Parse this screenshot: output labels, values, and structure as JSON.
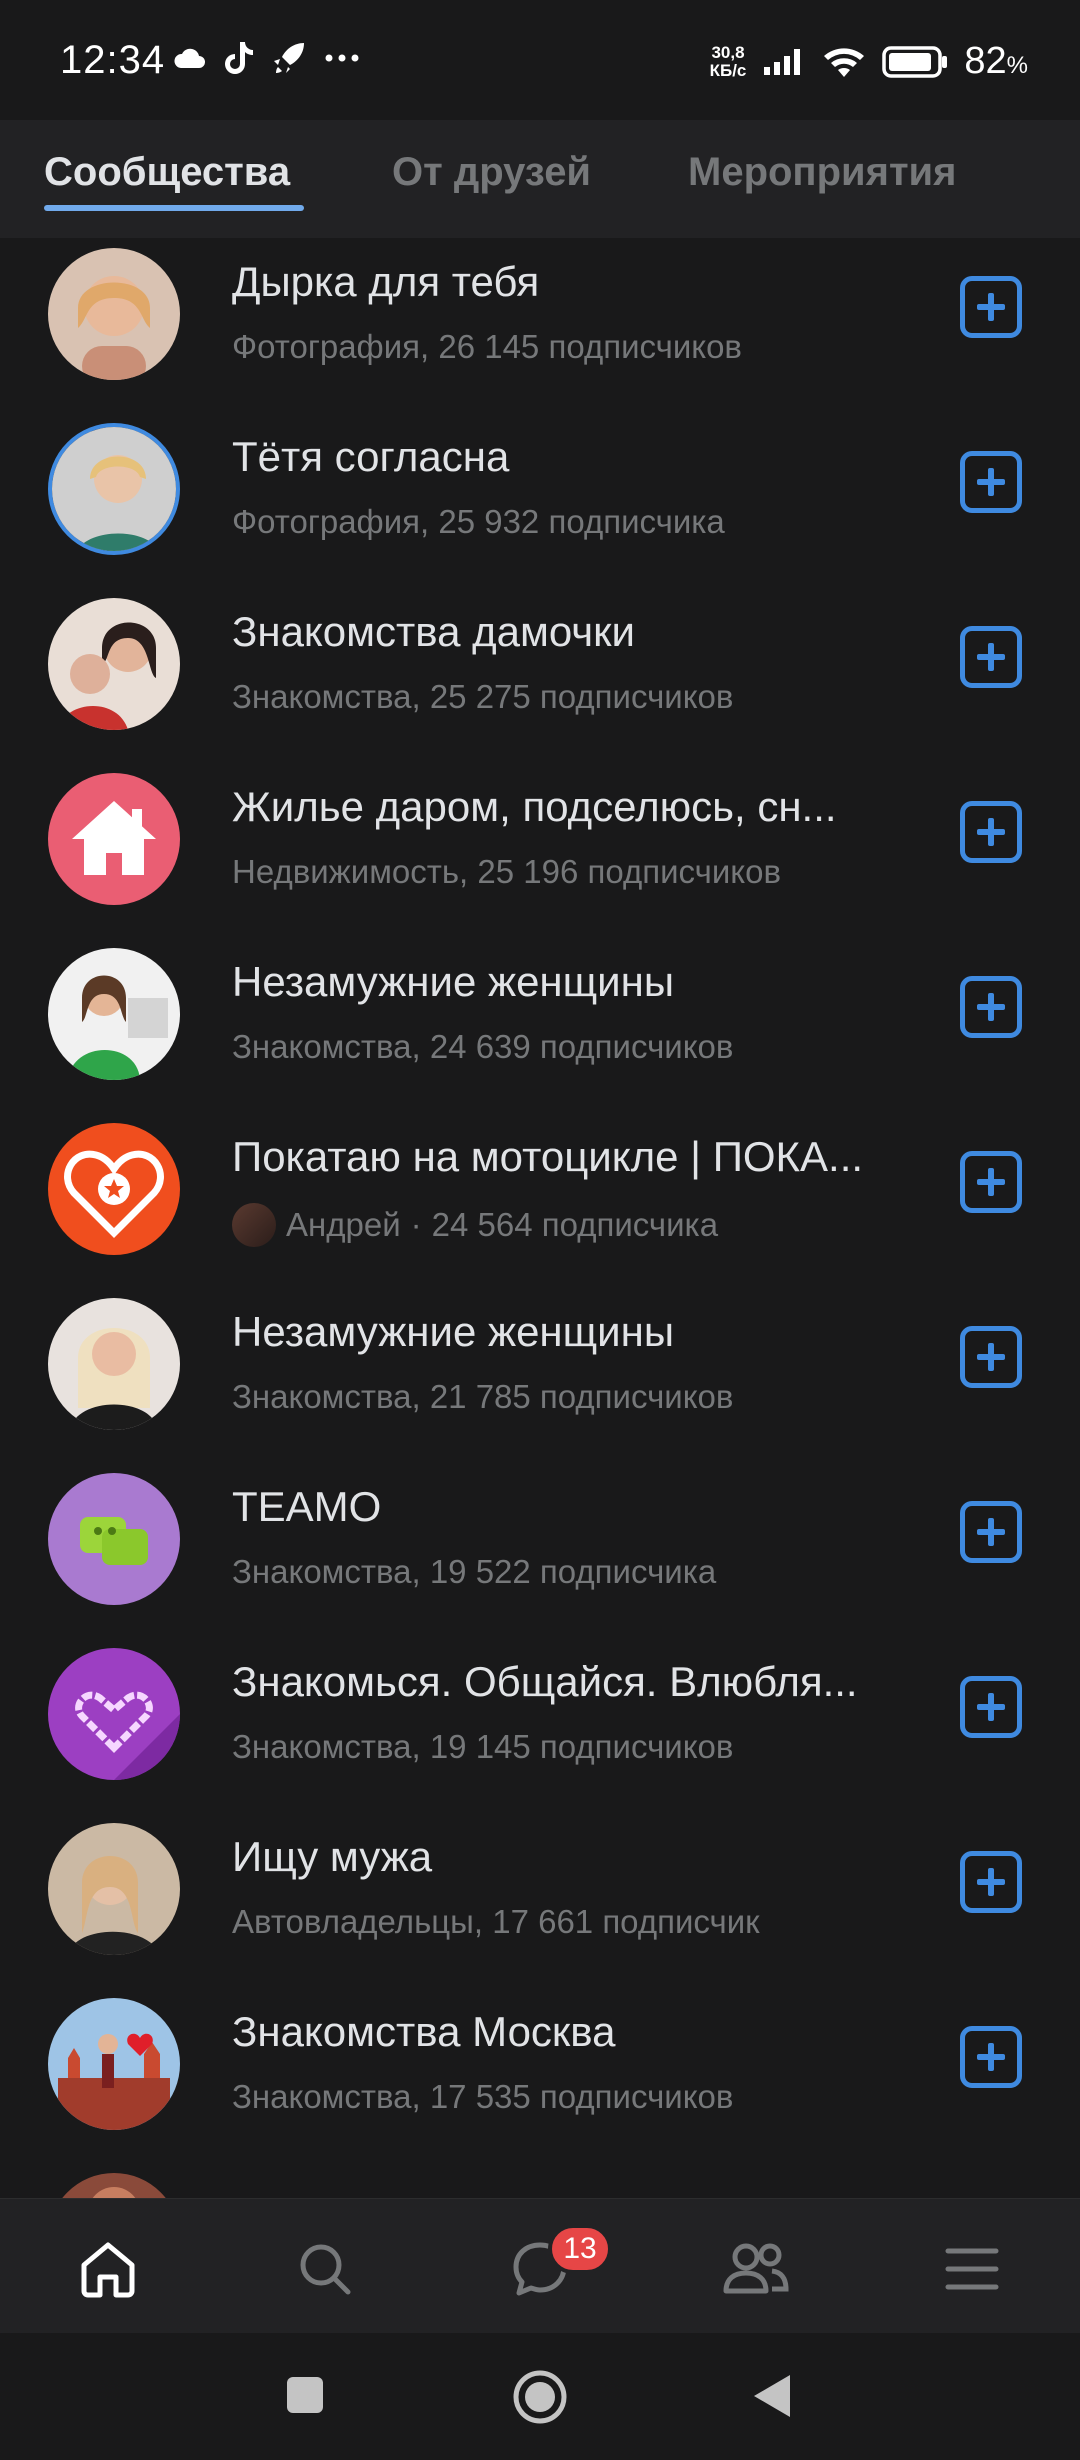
{
  "status_bar": {
    "time": "12:34",
    "net_speed_value": "30,8",
    "net_speed_unit": "КБ/с",
    "battery": "82",
    "battery_unit": "%"
  },
  "tabs": [
    {
      "label": "Сообщества",
      "active": true
    },
    {
      "label": "От друзей",
      "active": false
    },
    {
      "label": "Мероприятия",
      "active": false
    }
  ],
  "communities": [
    {
      "title": "Дырка для тебя",
      "subtitle": "Фотография, 26 145 подписчиков",
      "avatar_icon": "photo-avatar"
    },
    {
      "title": "Тётя согласна",
      "subtitle": "Фотография, 25 932 подписчика",
      "avatar_icon": "photo-avatar"
    },
    {
      "title": "Знакомства дамочки",
      "subtitle": "Знакомства, 25 275 подписчиков",
      "avatar_icon": "photo-avatar"
    },
    {
      "title": "Жилье даром, подселюсь, сн...",
      "subtitle": "Недвижимость, 25 196 подписчиков",
      "avatar_icon": "house-icon"
    },
    {
      "title": "Незамужние женщины",
      "subtitle": "Знакомства, 24 639 подписчиков",
      "avatar_icon": "photo-avatar"
    },
    {
      "title": "Покатаю на мотоцикле | ПОКА...",
      "owner": "Андрей",
      "separator": "·",
      "subscribers": "24 564 подписчика",
      "avatar_icon": "heart-star-logo"
    },
    {
      "title": "Незамужние женщины",
      "subtitle": "Знакомства, 21 785 подписчиков",
      "avatar_icon": "photo-avatar"
    },
    {
      "title": "TEAMO",
      "subtitle": "Знакомства, 19 522 подписчика",
      "avatar_icon": "teamo-logo"
    },
    {
      "title": "Знакомься. Общайся. Влюбля...",
      "subtitle": "Знакомства, 19 145 подписчиков",
      "avatar_icon": "heart-outline-logo"
    },
    {
      "title": "Ищу мужа",
      "subtitle": "Автовладельцы, 17 661 подписчик",
      "avatar_icon": "photo-avatar"
    },
    {
      "title": "Знакомства Москва",
      "subtitle": "Знакомства, 17 535 подписчиков",
      "avatar_icon": "moscow-heart-avatar"
    }
  ],
  "bottom_nav": {
    "items": [
      "home-icon",
      "search-icon",
      "messages-icon",
      "friends-icon",
      "menu-icon"
    ],
    "messages_badge": "13"
  },
  "colors": {
    "background": "#19191a",
    "accent": "#3f8ae0",
    "badge": "#e64646"
  }
}
